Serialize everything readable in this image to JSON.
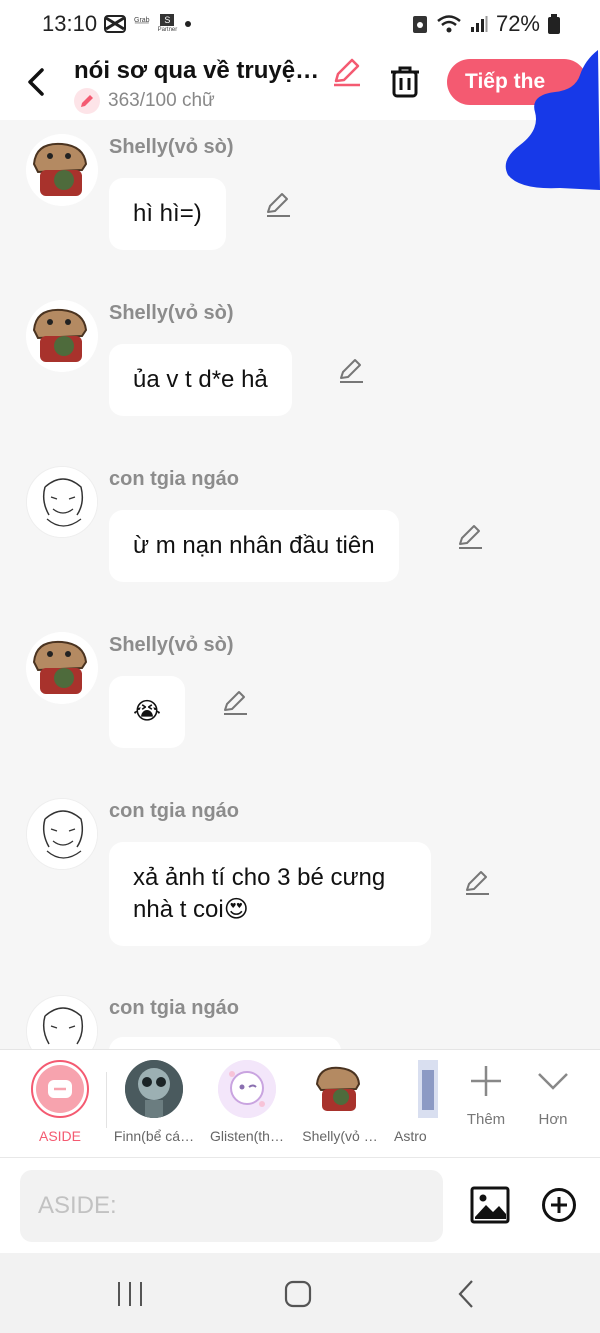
{
  "status": {
    "time": "13:10",
    "battery": "72%",
    "app_badge_labels": [
      "Grab",
      "Partner"
    ]
  },
  "header": {
    "title": "nói sơ qua về truyệ…",
    "word_count": "363/100 chữ",
    "continue_label": "Tiếp the",
    "accent_color": "#f45a71"
  },
  "messages": [
    {
      "sender": "Shelly(vỏ sò)",
      "text": "hì hì=)",
      "avatar": "shelly-avatar"
    },
    {
      "sender": "Shelly(vỏ sò)",
      "text": "ủa v t d*e hả",
      "avatar": "shelly-avatar"
    },
    {
      "sender": "con tgia ngáo",
      "text": "ừ m nạn nhân đầu tiên",
      "avatar": "author-avatar"
    },
    {
      "sender": "Shelly(vỏ sò)",
      "text": "😭",
      "avatar": "shelly-avatar"
    },
    {
      "sender": "con tgia ngáo",
      "text": "xả ảnh tí cho 3 bé cưng nhà t coi😍",
      "avatar": "author-avatar"
    },
    {
      "sender": "con tgia ngáo",
      "text": "",
      "avatar": "author-avatar"
    }
  ],
  "characters": [
    {
      "label": "ASIDE",
      "selected": true
    },
    {
      "label": "Finn(bể cá…"
    },
    {
      "label": "Glisten(th…"
    },
    {
      "label": "Shelly(vỏ …"
    },
    {
      "label": "Astro"
    }
  ],
  "tools": {
    "add_label": "Thêm",
    "more_label": "Hơn"
  },
  "input": {
    "placeholder": "ASIDE:",
    "value": ""
  }
}
